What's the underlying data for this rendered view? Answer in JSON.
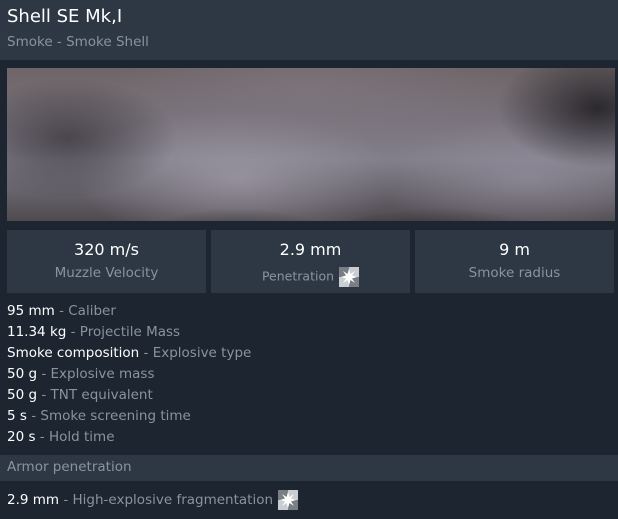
{
  "header": {
    "title": "Shell SE Mk,I",
    "subtitle": "Smoke - Smoke Shell"
  },
  "stats": [
    {
      "value": "320 m/s",
      "label": "Muzzle Velocity"
    },
    {
      "value": "2.9 mm",
      "label": "Penetration",
      "icon": "he-burst-icon"
    },
    {
      "value": "9 m",
      "label": "Smoke radius"
    }
  ],
  "properties": [
    {
      "value": "95 mm",
      "label": "Caliber"
    },
    {
      "value": "11.34 kg",
      "label": "Projectile Mass"
    },
    {
      "value": "Smoke composition",
      "label": "Explosive type"
    },
    {
      "value": "50 g",
      "label": "Explosive mass"
    },
    {
      "value": "50 g",
      "label": "TNT equivalent"
    },
    {
      "value": "5 s",
      "label": "Smoke screening time"
    },
    {
      "value": "20 s",
      "label": "Hold time"
    }
  ],
  "separator": " - ",
  "armor_penetration": {
    "title": "Armor penetration",
    "rows": [
      {
        "value": "2.9 mm",
        "label": "High-explosive fragmentation",
        "icon": "he-burst-icon"
      }
    ]
  },
  "colors": {
    "background": "#1c2530",
    "panel": "#2d3844",
    "muted_text": "#8b939c",
    "text": "#ffffff"
  }
}
